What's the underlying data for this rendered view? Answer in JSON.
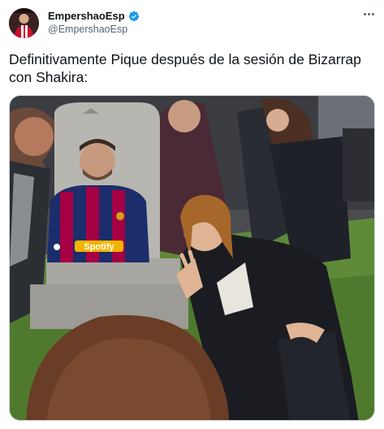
{
  "author": {
    "display_name": "EmpershaoEsp",
    "handle": "@EmpershaoEsp",
    "verified": true,
    "avatar_icon": "profile-avatar"
  },
  "tweet": {
    "text": "Definitivamente Pique después de la sesión de Bizarrap con Shakira:"
  },
  "media": {
    "type": "meme-image",
    "jersey_text": "Spotify"
  },
  "colors": {
    "verified_blue": "#1d9bf0",
    "text_primary": "#0f1419",
    "text_secondary": "#536471",
    "border": "#cfd9de"
  },
  "icons": {
    "verified": "verified-badge-icon",
    "more": "more-options-icon"
  }
}
